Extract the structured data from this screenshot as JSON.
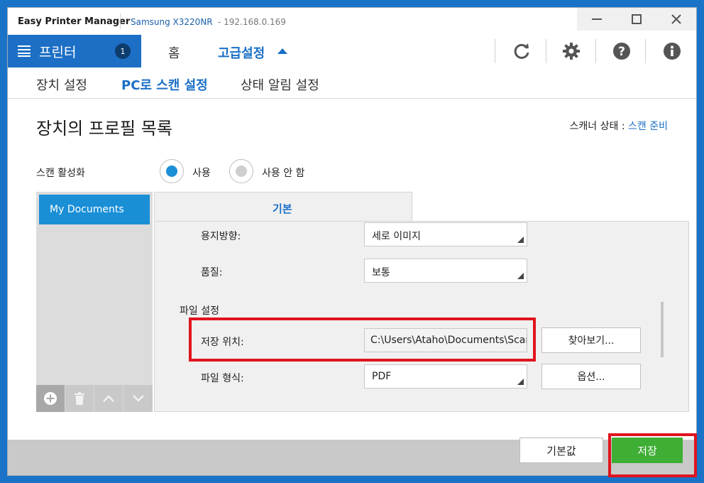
{
  "window": {
    "app_title": "Easy Printer Manager",
    "device_name": "Samsung X3220NR",
    "device_ip": " - 192.168.0.169",
    "controls": [
      "minimize",
      "maximize",
      "close"
    ]
  },
  "nav": {
    "printer_label": "프린터",
    "printer_count": "1",
    "home": "홈",
    "advanced": "고급설정",
    "icons": [
      "refresh-icon",
      "gear-icon",
      "help-icon",
      "info-icon"
    ]
  },
  "subtabs": {
    "device_settings": "장치 설정",
    "scan_to_pc": "PC로 스캔 설정",
    "status_alert": "상태 알림 설정"
  },
  "content": {
    "page_title": "장치의 프로필 목록",
    "scanner_status_label": "스캐너 상태 :",
    "scanner_status_value": "스캔 준비",
    "scan_enable_label": "스캔 활성화",
    "radio_on": "사용",
    "radio_off": "사용 안 함",
    "radio_selected": "사용"
  },
  "profiles": {
    "items": [
      "My Documents"
    ],
    "toolbar": [
      "add-icon",
      "trash-icon",
      "chevron-up-icon",
      "chevron-down-icon"
    ]
  },
  "detail": {
    "tab_label": "기본",
    "orientation_label": "용지방향:",
    "orientation_value": "세로 이미지",
    "quality_label": "품질:",
    "quality_value": "보통",
    "file_settings_heading": "파일 설정",
    "save_location_label": "저장 위치:",
    "save_location_value": "C:\\Users\\Ataho\\Documents\\Scan",
    "browse_button": "찾아보기...",
    "file_format_label": "파일 형식:",
    "file_format_value": "PDF",
    "options_button": "옵션..."
  },
  "footer": {
    "default_button": "기본값",
    "save_button": "저장"
  },
  "colors": {
    "accent": "#1c6fc5",
    "save_green": "#3fae35",
    "highlight_red": "#e0141e",
    "radio_selected": "#1a8fd6"
  }
}
